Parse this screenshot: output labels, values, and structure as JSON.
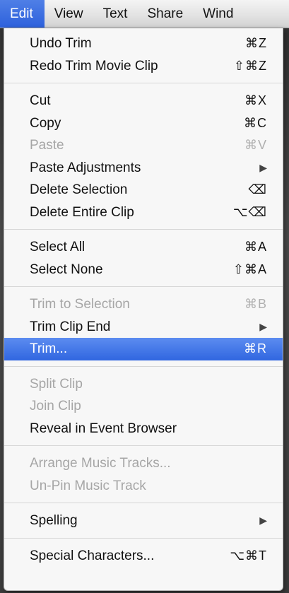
{
  "menubar": {
    "items": [
      {
        "label": "Edit"
      },
      {
        "label": "View"
      },
      {
        "label": "Text"
      },
      {
        "label": "Share"
      },
      {
        "label": "Wind"
      }
    ]
  },
  "menu": {
    "groups": [
      [
        {
          "label": "Undo Trim",
          "shortcut": "⌘Z"
        },
        {
          "label": "Redo Trim Movie Clip",
          "shortcut": "⇧⌘Z"
        }
      ],
      [
        {
          "label": "Cut",
          "shortcut": "⌘X"
        },
        {
          "label": "Copy",
          "shortcut": "⌘C"
        },
        {
          "label": "Paste",
          "shortcut": "⌘V",
          "disabled": true
        },
        {
          "label": "Paste Adjustments",
          "submenu": true
        },
        {
          "label": "Delete Selection",
          "shortcut": "⌫"
        },
        {
          "label": "Delete Entire Clip",
          "shortcut": "⌥⌫"
        }
      ],
      [
        {
          "label": "Select All",
          "shortcut": "⌘A"
        },
        {
          "label": "Select None",
          "shortcut": "⇧⌘A"
        }
      ],
      [
        {
          "label": "Trim to Selection",
          "shortcut": "⌘B",
          "disabled": true
        },
        {
          "label": "Trim Clip End",
          "submenu": true
        },
        {
          "label": "Trim...",
          "shortcut": "⌘R",
          "selected": true
        }
      ],
      [
        {
          "label": "Split Clip",
          "disabled": true
        },
        {
          "label": "Join Clip",
          "disabled": true
        },
        {
          "label": "Reveal in Event Browser"
        }
      ],
      [
        {
          "label": "Arrange Music Tracks...",
          "disabled": true
        },
        {
          "label": "Un-Pin Music Track",
          "disabled": true
        }
      ],
      [
        {
          "label": "Spelling",
          "submenu": true
        }
      ],
      [
        {
          "label": "Special Characters...",
          "shortcut": "⌥⌘T"
        }
      ]
    ],
    "submenu_glyph": "▶"
  },
  "colors": {
    "highlight": "#3066e0",
    "disabled_text": "#a6a6a6"
  }
}
